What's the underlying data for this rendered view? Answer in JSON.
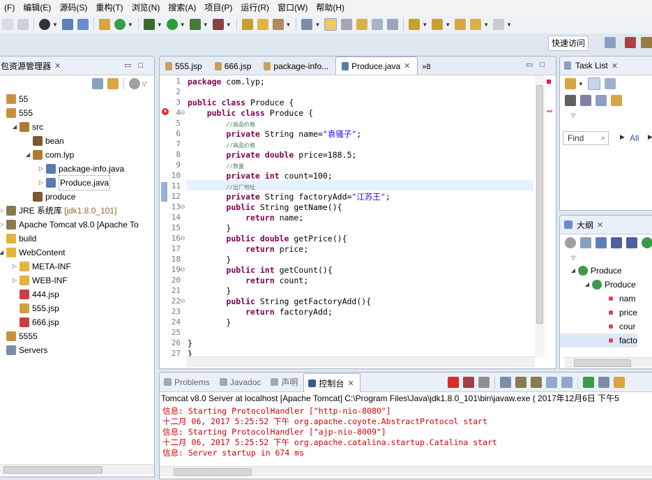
{
  "menu": [
    "(F)",
    "编辑(E)",
    "源码(S)",
    "重构(T)",
    "浏览(N)",
    "搜索(A)",
    "项目(P)",
    "运行(R)",
    "窗口(W)",
    "帮助(H)"
  ],
  "quick_access": "快速访问",
  "explorer": {
    "title": "包资源管理器",
    "items": [
      {
        "label": "55",
        "deco": ""
      },
      {
        "label": "555",
        "deco": ""
      },
      {
        "label": "src",
        "deco": ""
      },
      {
        "label": "bean",
        "deco": ""
      },
      {
        "label": "com.lyp",
        "deco": ""
      },
      {
        "label": "package-info.java",
        "deco": ""
      },
      {
        "label": "Produce.java",
        "deco": ""
      },
      {
        "label": "produce",
        "deco": ""
      },
      {
        "label": "JRE 系统库",
        "deco": "[jdk1.8.0_101]"
      },
      {
        "label": "Apache Tomcat v8.0 [Apache To",
        "deco": ""
      },
      {
        "label": "build",
        "deco": ""
      },
      {
        "label": "WebContent",
        "deco": ""
      },
      {
        "label": "META-INF",
        "deco": ""
      },
      {
        "label": "WEB-INF",
        "deco": ""
      },
      {
        "label": "444.jsp",
        "deco": ""
      },
      {
        "label": "555.jsp",
        "deco": ""
      },
      {
        "label": "666.jsp",
        "deco": ""
      },
      {
        "label": "5555",
        "deco": ""
      },
      {
        "label": "Servers",
        "deco": ""
      }
    ]
  },
  "editor": {
    "tabs": [
      "555.jsp",
      "666.jsp",
      "package-info...",
      "Produce.java"
    ],
    "overflow": "»8",
    "line_numbers": [
      "1",
      "2",
      "3",
      "4",
      "5",
      "6",
      "7",
      "8",
      "9",
      "10",
      "11",
      "12",
      "13",
      "14",
      "15",
      "16",
      "17",
      "18",
      "19",
      "20",
      "21",
      "22",
      "23",
      "24",
      "25",
      "26",
      "27"
    ],
    "code": [
      [
        [
          "kw",
          "package"
        ],
        [
          "",
          "com.lyp;"
        ]
      ],
      [],
      [
        [
          "kw",
          "public class"
        ],
        [
          "",
          "Produce {"
        ]
      ],
      [
        [
          "",
          "    "
        ],
        [
          "kw",
          "public class"
        ],
        [
          "",
          "Produce {"
        ]
      ],
      [
        [
          "",
          "        "
        ],
        [
          "cm",
          "//商品价格"
        ]
      ],
      [
        [
          "",
          "        "
        ],
        [
          "kw",
          "private"
        ],
        [
          "",
          "String name="
        ],
        [
          "str",
          "\"袁骚子\""
        ],
        [
          "",
          ";"
        ]
      ],
      [
        [
          "",
          "        "
        ],
        [
          "cm",
          "//商品价格"
        ]
      ],
      [
        [
          "",
          "        "
        ],
        [
          "kw",
          "private double"
        ],
        [
          "",
          "price=188.5;"
        ]
      ],
      [
        [
          "",
          "        "
        ],
        [
          "cm",
          "//数量"
        ]
      ],
      [
        [
          "",
          "        "
        ],
        [
          "kw",
          "private int"
        ],
        [
          "",
          "count=100;"
        ]
      ],
      [
        [
          "",
          "        "
        ],
        [
          "cm",
          "//出厂地址"
        ]
      ],
      [
        [
          "",
          "        "
        ],
        [
          "kw",
          "private"
        ],
        [
          "",
          "String factoryAdd="
        ],
        [
          "str",
          "\"江苏王\""
        ],
        [
          "",
          ";"
        ]
      ],
      [
        [
          "",
          "        "
        ],
        [
          "kw",
          "public"
        ],
        [
          "",
          "String getName(){"
        ]
      ],
      [
        [
          "",
          "            "
        ],
        [
          "kw",
          "return"
        ],
        [
          "",
          "name;"
        ]
      ],
      [
        [
          "",
          "        }"
        ]
      ],
      [
        [
          "",
          "        "
        ],
        [
          "kw",
          "public double"
        ],
        [
          "",
          "getPrice(){"
        ]
      ],
      [
        [
          "",
          "            "
        ],
        [
          "kw",
          "return"
        ],
        [
          "",
          "price;"
        ]
      ],
      [
        [
          "",
          "        }"
        ]
      ],
      [
        [
          "",
          "        "
        ],
        [
          "kw",
          "public int"
        ],
        [
          "",
          "getCount(){"
        ]
      ],
      [
        [
          "",
          "            "
        ],
        [
          "kw",
          "return"
        ],
        [
          "",
          "count;"
        ]
      ],
      [
        [
          "",
          "        }"
        ]
      ],
      [
        [
          "",
          "        "
        ],
        [
          "kw",
          "public"
        ],
        [
          "",
          "String getFactoryAdd(){"
        ]
      ],
      [
        [
          "",
          "            "
        ],
        [
          "kw",
          "return"
        ],
        [
          "",
          "factoryAdd;"
        ]
      ],
      [
        [
          "",
          "        }"
        ]
      ],
      [],
      [
        [
          "",
          "}"
        ]
      ],
      [
        [
          "",
          "}"
        ]
      ]
    ]
  },
  "tasklist": {
    "title": "Task List",
    "find_placeholder": "Find",
    "all_label": "All"
  },
  "outline": {
    "title": "大纲",
    "items": [
      "Produce",
      "Produce",
      "nam",
      "price",
      "cour",
      "facto"
    ]
  },
  "console": {
    "tabs": [
      "Problems",
      "Javadoc",
      "声明",
      "控制台"
    ],
    "header": "Tomcat v8.0 Server at localhost [Apache Tomcat] C:\\Program Files\\Java\\jdk1.8.0_101\\bin\\javaw.exe ( 2017年12月6日 下午5",
    "lines": [
      "信息: Starting ProtocolHandler [\"http-nio-8080\"]",
      "十二月 06, 2017 5:25:52 下午 org.apache.coyote.AbstractProtocol start",
      "信息: Starting ProtocolHandler [\"ajp-nio-8009\"]",
      "十二月 06, 2017 5:25:52 下午 org.apache.catalina.startup.Catalina start",
      "信息: Server startup in 674 ms"
    ]
  }
}
